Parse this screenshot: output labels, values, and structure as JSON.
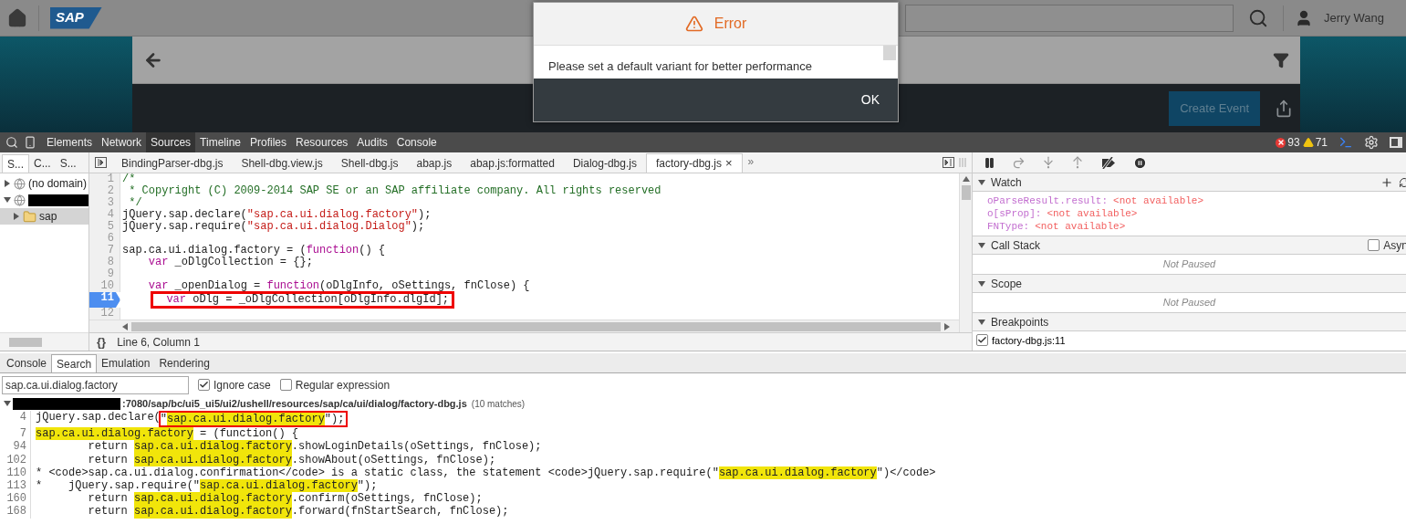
{
  "app": {
    "logo": "SAP",
    "user": "Jerry Wang",
    "create_button": "Create Event"
  },
  "dialog": {
    "title": "Error",
    "message": "Please set a default variant for better performance",
    "button": "OK"
  },
  "devtools": {
    "tabs": [
      {
        "label": "Elements",
        "selected": false
      },
      {
        "label": "Network",
        "selected": false
      },
      {
        "label": "Sources",
        "selected": true
      },
      {
        "label": "Timeline",
        "selected": false
      },
      {
        "label": "Profiles",
        "selected": false
      },
      {
        "label": "Resources",
        "selected": false
      },
      {
        "label": "Audits",
        "selected": false
      },
      {
        "label": "Console",
        "selected": false
      }
    ],
    "errors": "93",
    "warnings": "71"
  },
  "navigator": {
    "tabs": [
      {
        "label": "S...",
        "selected": true
      },
      {
        "label": "C...",
        "selected": false
      },
      {
        "label": "S...",
        "selected": false
      }
    ],
    "tree": [
      {
        "label": "(no domain)",
        "kind": "domain",
        "expanded": false,
        "selected": false,
        "redacted": false
      },
      {
        "kind": "domain",
        "expanded": true,
        "selected": false,
        "redacted": true,
        "children": [
          {
            "label": "sap",
            "kind": "folder",
            "expanded": false,
            "selected": true,
            "redacted": false
          }
        ]
      }
    ]
  },
  "file_tabs": {
    "tabs": [
      {
        "label": "BindingParser-dbg.js",
        "selected": false
      },
      {
        "label": "Shell-dbg.view.js",
        "selected": false
      },
      {
        "label": "Shell-dbg.js",
        "selected": false
      },
      {
        "label": "abap.js",
        "selected": false
      },
      {
        "label": "abap.js:formatted",
        "selected": false
      },
      {
        "label": "Dialog-dbg.js",
        "selected": false
      },
      {
        "label": "factory-dbg.js",
        "selected": true,
        "close": "×"
      }
    ],
    "more": "»"
  },
  "code": [
    {
      "number": "1",
      "breakpoint": false,
      "segments": [
        {
          "kind": "comment",
          "text": "/*"
        }
      ]
    },
    {
      "number": "2",
      "breakpoint": false,
      "segments": [
        {
          "kind": "comment",
          "text": " * Copyright (C) 2009-2014 SAP SE or an SAP affiliate company. All rights reserved"
        }
      ]
    },
    {
      "number": "3",
      "breakpoint": false,
      "segments": [
        {
          "kind": "comment",
          "text": " */"
        }
      ]
    },
    {
      "number": "4",
      "breakpoint": false,
      "segments": [
        {
          "kind": "plain",
          "text": "jQuery.sap.declare("
        },
        {
          "kind": "string",
          "text": "\"sap.ca.ui.dialog.factory\""
        },
        {
          "kind": "plain",
          "text": ");"
        }
      ]
    },
    {
      "number": "5",
      "breakpoint": false,
      "segments": [
        {
          "kind": "plain",
          "text": "jQuery.sap.require("
        },
        {
          "kind": "string",
          "text": "\"sap.ca.ui.dialog.Dialog\""
        },
        {
          "kind": "plain",
          "text": ");"
        }
      ]
    },
    {
      "number": "6",
      "breakpoint": false
    },
    {
      "number": "7",
      "breakpoint": false,
      "segments": [
        {
          "kind": "plain",
          "text": "sap.ca.ui.dialog.factory = ("
        },
        {
          "kind": "keyword",
          "text": "function"
        },
        {
          "kind": "plain",
          "text": "() {"
        }
      ]
    },
    {
      "number": "8",
      "breakpoint": false,
      "segments": [
        {
          "kind": "keyword",
          "text": "    var"
        },
        {
          "kind": "plain",
          "text": " _oDlgCollection = {};"
        }
      ]
    },
    {
      "number": "9",
      "breakpoint": false
    },
    {
      "number": "10",
      "breakpoint": false,
      "segments": [
        {
          "kind": "keyword",
          "text": "    var"
        },
        {
          "kind": "plain",
          "text": " _openDialog = "
        },
        {
          "kind": "keyword",
          "text": "function"
        },
        {
          "kind": "plain",
          "text": "(oDlgInfo, oSettings, fnClose) {"
        }
      ]
    },
    {
      "number": "11",
      "breakpoint": true,
      "segments": [
        {
          "kind": "outline",
          "segments": [
            {
              "kind": "keyword",
              "text": "  var"
            },
            {
              "kind": "plain",
              "text": " oDlg = _oDlgCollection[oDlgInfo.dlgId];"
            }
          ]
        }
      ]
    },
    {
      "number": "12",
      "breakpoint": false
    }
  ],
  "status": {
    "format_button": "{}",
    "position": "Line 6, Column 1"
  },
  "debugger": {
    "sections": [
      {
        "title": "Watch",
        "kind": "watch",
        "items": [
          {
            "name": "oParseResult.result:",
            "value": "<not available>"
          },
          {
            "name": "o[sProp]:",
            "value": "<not available>"
          },
          {
            "name": "FNType:",
            "value": "<not available>"
          }
        ]
      },
      {
        "title": "Call Stack",
        "kind": "message",
        "message": "Not Paused",
        "checkbox": {
          "label": "Asyn",
          "checked": false
        }
      },
      {
        "title": "Scope",
        "kind": "message",
        "message": "Not Paused"
      },
      {
        "title": "Breakpoints",
        "kind": "breakpoints",
        "items": [
          {
            "label": "factory-dbg.js:11",
            "checked": true
          }
        ]
      }
    ]
  },
  "drawer": {
    "tabs": [
      {
        "label": "Console",
        "selected": false
      },
      {
        "label": "Search",
        "selected": true
      },
      {
        "label": "Emulation",
        "selected": false
      },
      {
        "label": "Rendering",
        "selected": false
      }
    ],
    "search": {
      "value": "sap.ca.ui.dialog.factory",
      "options": [
        {
          "label": "Ignore case",
          "checked": true
        },
        {
          "label": "Regular expression",
          "checked": false
        }
      ]
    },
    "result": {
      "path": ":7080/sap/bc/ui5_ui5/ui2/ushell/resources/sap/ca/ui/dialog/factory-dbg.js",
      "count": "(10 matches)",
      "expanded": true,
      "redacted": true,
      "lines": [
        {
          "number": "4",
          "segments": [
            {
              "kind": "text",
              "text": "jQuery.sap.declare("
            },
            {
              "kind": "outline",
              "segments": [
                {
                  "kind": "text",
                  "text": "\""
                },
                {
                  "kind": "match",
                  "text": "sap.ca.ui.dialog.factory"
                },
                {
                  "kind": "text",
                  "text": "\");"
                }
              ]
            }
          ]
        },
        {
          "number": "7",
          "segments": [
            {
              "kind": "match",
              "text": "sap.ca.ui.dialog.factory"
            },
            {
              "kind": "text",
              "text": " = (function() {"
            }
          ]
        },
        {
          "number": "94",
          "segments": [
            {
              "kind": "text",
              "text": "        return "
            },
            {
              "kind": "match",
              "text": "sap.ca.ui.dialog.factory"
            },
            {
              "kind": "text",
              "text": ".showLoginDetails(oSettings, fnClose);"
            }
          ]
        },
        {
          "number": "102",
          "segments": [
            {
              "kind": "text",
              "text": "        return "
            },
            {
              "kind": "match",
              "text": "sap.ca.ui.dialog.factory"
            },
            {
              "kind": "text",
              "text": ".showAbout(oSettings, fnClose);"
            }
          ]
        },
        {
          "number": "110",
          "segments": [
            {
              "kind": "text",
              "text": "* <code>sap.ca.ui.dialog.confirmation</code> is a static class, the statement <code>jQuery.sap.require(\""
            },
            {
              "kind": "match",
              "text": "sap.ca.ui.dialog.factory"
            },
            {
              "kind": "text",
              "text": "\")</code>"
            }
          ]
        },
        {
          "number": "113",
          "segments": [
            {
              "kind": "text",
              "text": "*    jQuery.sap.require(\""
            },
            {
              "kind": "match",
              "text": "sap.ca.ui.dialog.factory"
            },
            {
              "kind": "text",
              "text": "\");"
            }
          ]
        },
        {
          "number": "160",
          "segments": [
            {
              "kind": "text",
              "text": "        return "
            },
            {
              "kind": "match",
              "text": "sap.ca.ui.dialog.factory"
            },
            {
              "kind": "text",
              "text": ".confirm(oSettings, fnClose);"
            }
          ]
        },
        {
          "number": "168",
          "segments": [
            {
              "kind": "text",
              "text": "        return "
            },
            {
              "kind": "match",
              "text": "sap.ca.ui.dialog.factory"
            },
            {
              "kind": "text",
              "text": ".forward(fnStartSearch, fnClose);"
            }
          ]
        }
      ]
    }
  }
}
